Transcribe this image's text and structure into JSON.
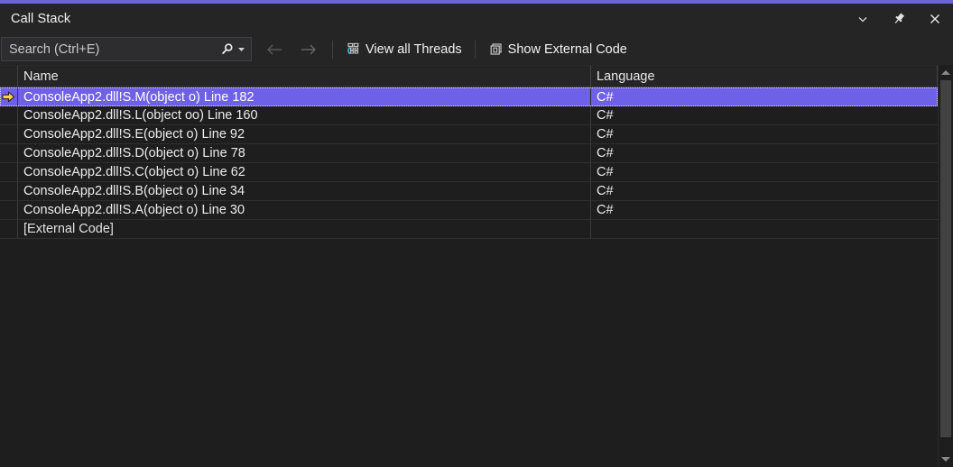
{
  "window": {
    "title": "Call Stack",
    "accent_color": "#6c63d8",
    "controls": [
      {
        "name": "chevron-down",
        "label": "Window Position Menu"
      },
      {
        "name": "pin",
        "label": "Auto Hide"
      },
      {
        "name": "close",
        "label": "Close"
      }
    ]
  },
  "toolbar": {
    "search": {
      "placeholder": "Search (Ctrl+E)",
      "value": "",
      "icon": "search-icon",
      "dropdown_icon": "chevron-down-icon"
    },
    "nav": {
      "back_icon": "arrow-left-icon",
      "forward_icon": "arrow-right-icon",
      "back_enabled": false,
      "forward_enabled": false
    },
    "view_all_threads": {
      "label": "View all Threads",
      "icon": "threads-icon",
      "icon_accent": "#4ec9e0"
    },
    "show_external_code": {
      "label": "Show External Code",
      "icon": "windows-stack-icon"
    }
  },
  "grid": {
    "columns": [
      {
        "key": "name",
        "label": "Name"
      },
      {
        "key": "language",
        "label": "Language"
      }
    ],
    "selection_color": "#6f60e8",
    "marker_color": "#ffd700",
    "rows": [
      {
        "marker": true,
        "selected": true,
        "name": "ConsoleApp2.dll!S.M(object o) Line 182",
        "language": "C#"
      },
      {
        "marker": false,
        "selected": false,
        "name": "ConsoleApp2.dll!S.L(object oo) Line 160",
        "language": "C#"
      },
      {
        "marker": false,
        "selected": false,
        "name": "ConsoleApp2.dll!S.E(object o) Line 92",
        "language": "C#"
      },
      {
        "marker": false,
        "selected": false,
        "name": "ConsoleApp2.dll!S.D(object o) Line 78",
        "language": "C#"
      },
      {
        "marker": false,
        "selected": false,
        "name": "ConsoleApp2.dll!S.C(object o) Line 62",
        "language": "C#"
      },
      {
        "marker": false,
        "selected": false,
        "name": "ConsoleApp2.dll!S.B(object o) Line 34",
        "language": "C#"
      },
      {
        "marker": false,
        "selected": false,
        "name": "ConsoleApp2.dll!S.A(object o) Line 30",
        "language": "C#"
      },
      {
        "marker": false,
        "selected": false,
        "name": "[External Code]",
        "language": ""
      }
    ]
  },
  "scrollbar": {
    "up_icon": "triangle-up-icon",
    "down_icon": "triangle-down-icon"
  }
}
